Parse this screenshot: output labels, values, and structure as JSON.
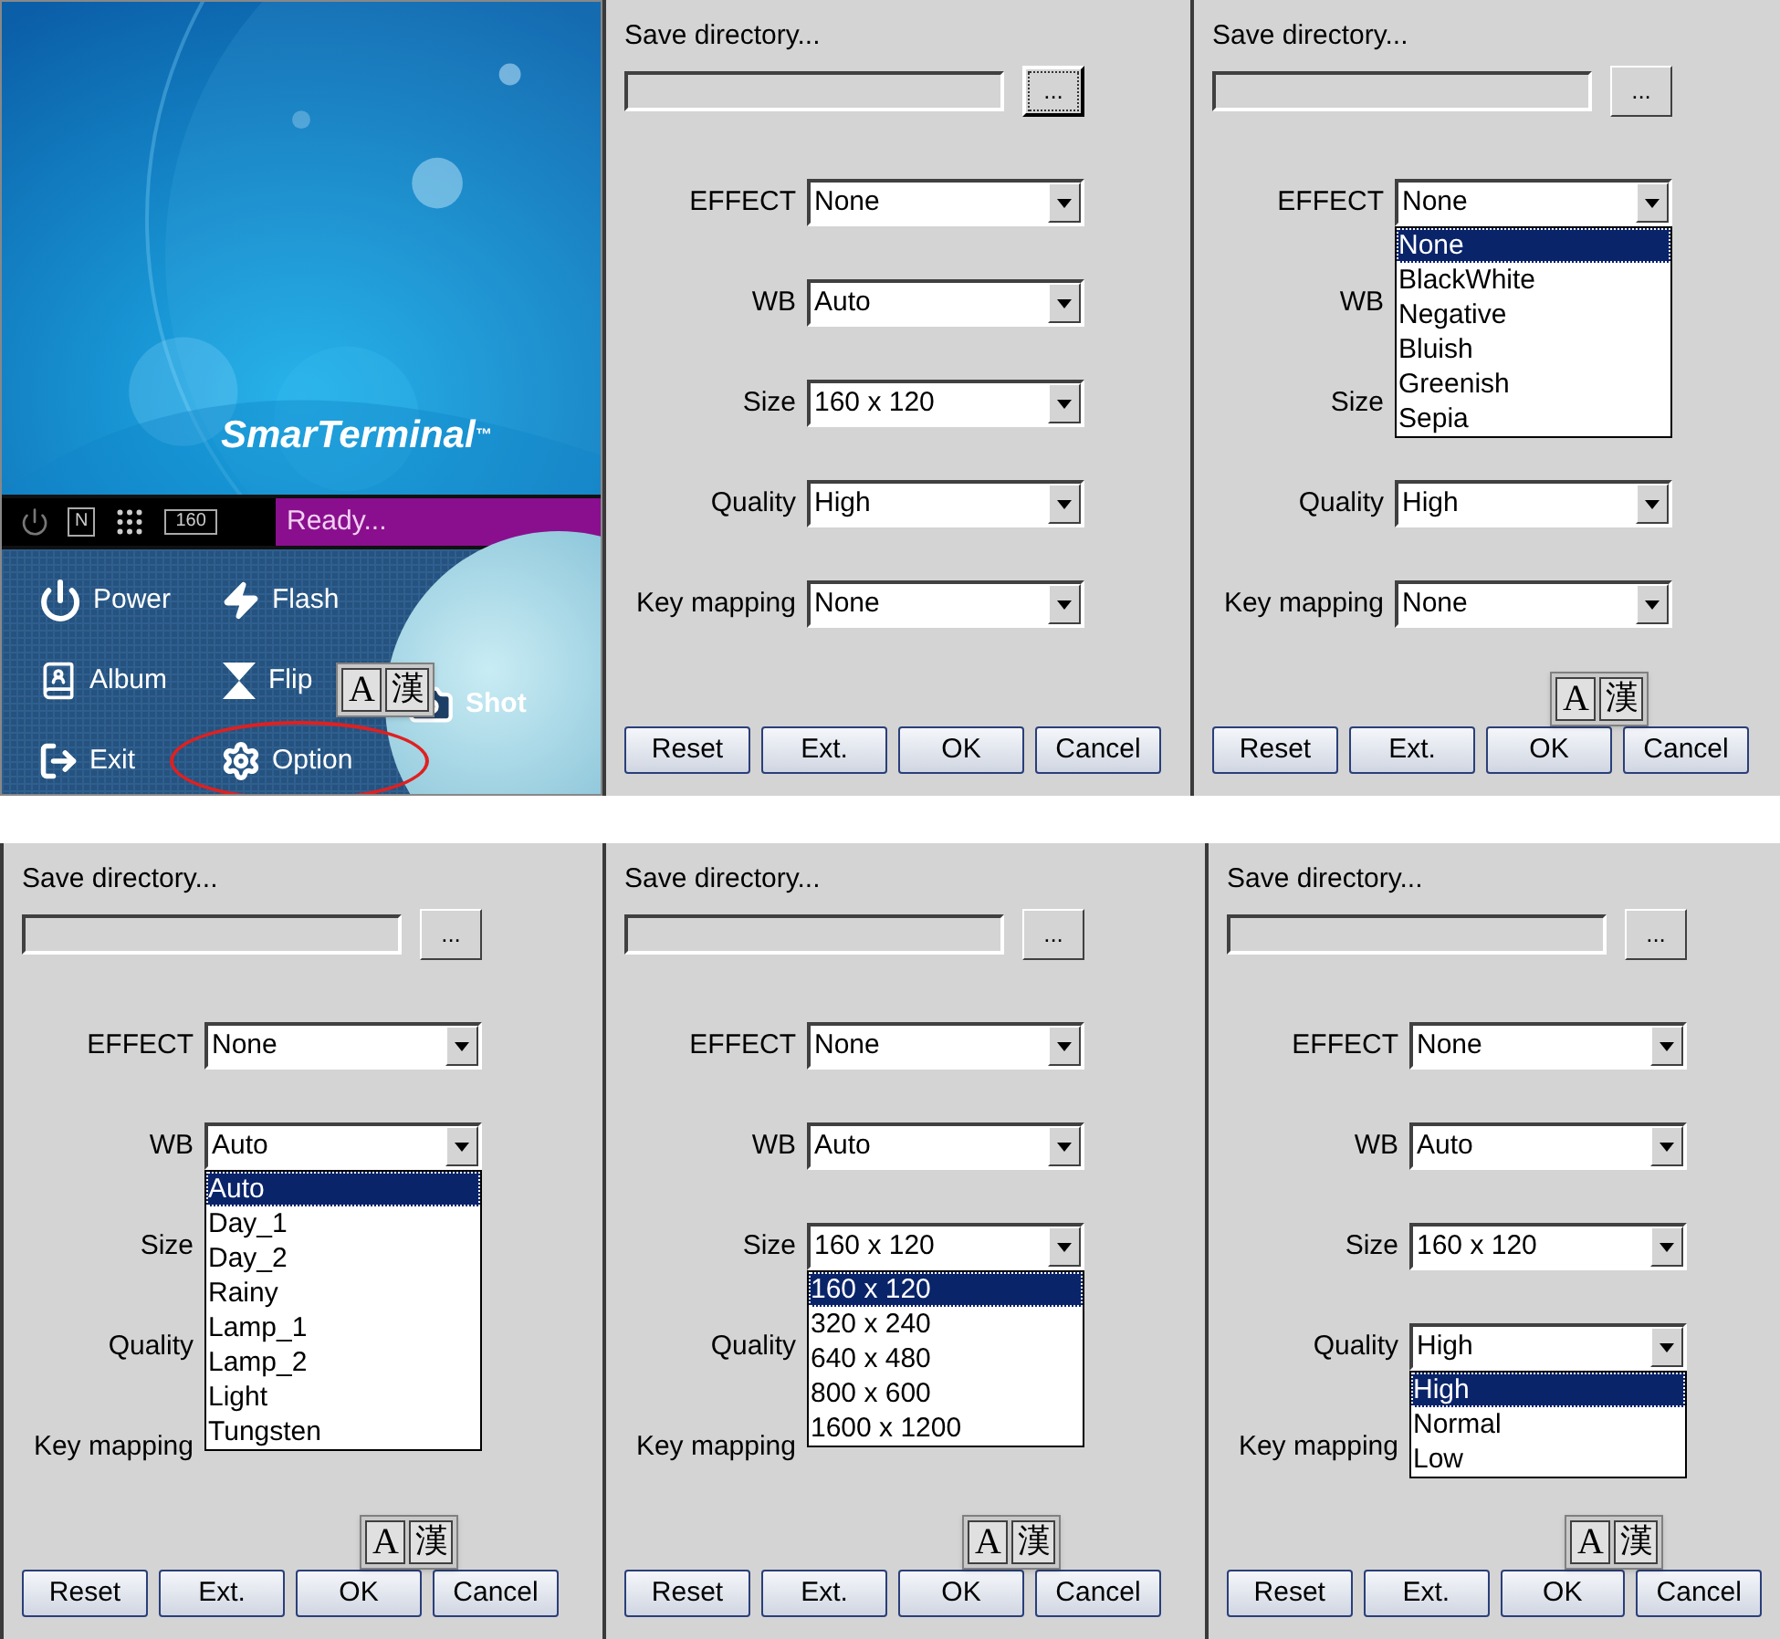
{
  "app": {
    "logo": "SmarTerminal",
    "logo_mark": "™",
    "status_bar": {
      "mode": "N",
      "resolution": "160",
      "message": "Ready..."
    },
    "menu": [
      {
        "label": "Power",
        "highlighted": false
      },
      {
        "label": "Flash",
        "highlighted": false
      },
      {
        "label": "Album",
        "highlighted": false
      },
      {
        "label": "Flip",
        "highlighted": false
      },
      {
        "label": "Exit",
        "highlighted": false
      },
      {
        "label": "Option",
        "highlighted": true
      }
    ],
    "shot": "Shot",
    "ime": {
      "latin": "A",
      "cjk": "漢"
    }
  },
  "dialogs": [
    {
      "save_label": "Save directory...",
      "browse": {
        "label": "...",
        "focused": true
      },
      "fields": [
        {
          "label": "EFFECT",
          "value": "None",
          "expanded": false
        },
        {
          "label": "WB",
          "value": "Auto",
          "expanded": false
        },
        {
          "label": "Size",
          "value": "160 x 120",
          "expanded": false
        },
        {
          "label": "Quality",
          "value": "High",
          "expanded": false
        },
        {
          "label": "Key mapping",
          "value": "None",
          "expanded": false
        }
      ],
      "buttons": [
        "Reset",
        "Ext.",
        "OK",
        "Cancel"
      ]
    },
    {
      "save_label": "Save directory...",
      "browse": {
        "label": "...",
        "focused": false
      },
      "fields": [
        {
          "label": "EFFECT",
          "value": "None",
          "expanded": true,
          "options": [
            {
              "label": "None",
              "selected": true
            },
            {
              "label": "BlackWhite",
              "selected": false
            },
            {
              "label": "Negative",
              "selected": false
            },
            {
              "label": "Bluish",
              "selected": false
            },
            {
              "label": "Greenish",
              "selected": false
            },
            {
              "label": "Sepia",
              "selected": false
            }
          ]
        },
        {
          "label": "WB",
          "expanded": false
        },
        {
          "label": "Size",
          "expanded": false
        },
        {
          "label": "Quality",
          "value": "High",
          "expanded": false
        },
        {
          "label": "Key mapping",
          "value": "None",
          "expanded": false
        }
      ],
      "buttons": [
        "Reset",
        "Ext.",
        "OK",
        "Cancel"
      ],
      "ime": {
        "latin": "A",
        "cjk": "漢"
      }
    },
    {
      "save_label": "Save directory...",
      "browse": {
        "label": "...",
        "focused": false
      },
      "fields": [
        {
          "label": "EFFECT",
          "value": "None",
          "expanded": false
        },
        {
          "label": "WB",
          "value": "Auto",
          "expanded": true,
          "options": [
            {
              "label": "Auto",
              "selected": true
            },
            {
              "label": "Day_1",
              "selected": false
            },
            {
              "label": "Day_2",
              "selected": false
            },
            {
              "label": "Rainy",
              "selected": false
            },
            {
              "label": "Lamp_1",
              "selected": false
            },
            {
              "label": "Lamp_2",
              "selected": false
            },
            {
              "label": "Light",
              "selected": false
            },
            {
              "label": "Tungsten",
              "selected": false
            }
          ]
        },
        {
          "label": "Size",
          "expanded": false
        },
        {
          "label": "Quality",
          "expanded": false
        },
        {
          "label": "Key mapping",
          "expanded": false
        }
      ],
      "buttons": [
        "Reset",
        "Ext.",
        "OK",
        "Cancel"
      ],
      "ime": {
        "latin": "A",
        "cjk": "漢"
      }
    },
    {
      "save_label": "Save directory...",
      "browse": {
        "label": "...",
        "focused": false
      },
      "fields": [
        {
          "label": "EFFECT",
          "value": "None",
          "expanded": false
        },
        {
          "label": "WB",
          "value": "Auto",
          "expanded": false
        },
        {
          "label": "Size",
          "value": "160 x 120",
          "expanded": true,
          "options": [
            {
              "label": "160 x 120",
              "selected": true
            },
            {
              "label": "320 x 240",
              "selected": false
            },
            {
              "label": "640 x 480",
              "selected": false
            },
            {
              "label": "800 x 600",
              "selected": false
            },
            {
              "label": "1600 x 1200",
              "selected": false
            }
          ]
        },
        {
          "label": "Quality",
          "expanded": false
        },
        {
          "label": "Key mapping",
          "expanded": false
        }
      ],
      "buttons": [
        "Reset",
        "Ext.",
        "OK",
        "Cancel"
      ],
      "ime": {
        "latin": "A",
        "cjk": "漢"
      }
    },
    {
      "save_label": "Save directory...",
      "browse": {
        "label": "...",
        "focused": false
      },
      "fields": [
        {
          "label": "EFFECT",
          "value": "None",
          "expanded": false
        },
        {
          "label": "WB",
          "value": "Auto",
          "expanded": false
        },
        {
          "label": "Size",
          "value": "160 x 120",
          "expanded": false
        },
        {
          "label": "Quality",
          "value": "High",
          "expanded": true,
          "options": [
            {
              "label": "High",
              "selected": true
            },
            {
              "label": "Normal",
              "selected": false
            },
            {
              "label": "Low",
              "selected": false
            }
          ]
        },
        {
          "label": "Key mapping",
          "expanded": false
        }
      ],
      "buttons": [
        "Reset",
        "Ext.",
        "OK",
        "Cancel"
      ],
      "ime": {
        "latin": "A",
        "cjk": "漢"
      }
    }
  ]
}
